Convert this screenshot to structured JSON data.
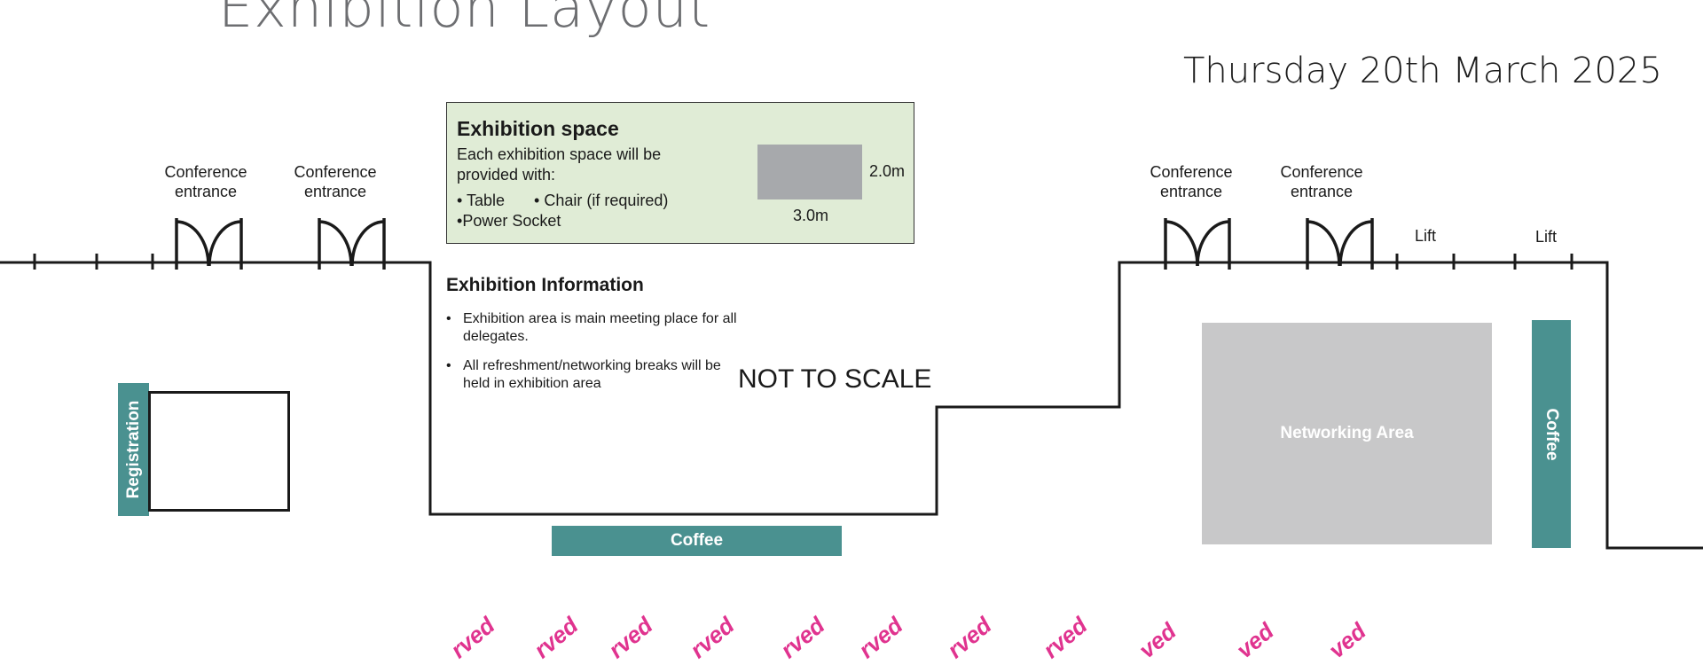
{
  "header": {
    "title": "Exhibition Layout",
    "date": "Thursday 20th March 2025"
  },
  "entrances": [
    {
      "line1": "Conference",
      "line2": "entrance"
    },
    {
      "line1": "Conference",
      "line2": "entrance"
    },
    {
      "line1": "Conference",
      "line2": "entrance"
    },
    {
      "line1": "Conference",
      "line2": "entrance"
    }
  ],
  "lifts": [
    "Lift",
    "Lift"
  ],
  "info_box": {
    "title": "Exhibition space",
    "intro": "Each exhibition space will be provided with:",
    "items": [
      "Table",
      "Chair (if required)",
      "Power Socket"
    ],
    "bullet": "•",
    "depth": "2.0m",
    "width": "3.0m"
  },
  "exhibition_info": {
    "title": "Exhibition Information",
    "notes": [
      "Exhibition area is main meeting place for all delegates.",
      "All refreshment/networking breaks will be held in exhibition area"
    ]
  },
  "scale_note": "NOT TO SCALE",
  "areas": {
    "registration": "Registration",
    "coffee_main": "Coffee",
    "coffee_side": "Coffee",
    "networking": "Networking Area"
  },
  "reserved_labels": [
    "rved",
    "rved",
    "rved",
    "rved",
    "rved",
    "rved",
    "rved",
    "rved",
    "ved",
    "ved",
    "ved"
  ],
  "colors": {
    "teal": "#4a9190",
    "info_box_bg": "#e0ecd6",
    "networking_grey": "#c8c8c9",
    "reserved_magenta": "#e0338f",
    "title_grey": "#6d6e71"
  }
}
